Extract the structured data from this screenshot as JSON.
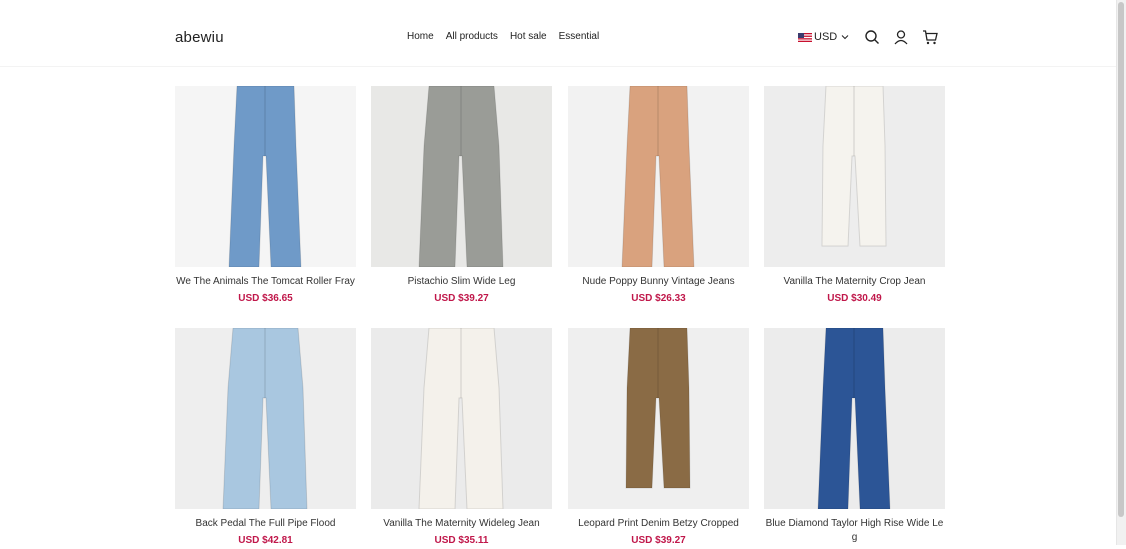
{
  "header": {
    "logo": "abewiu",
    "nav": [
      "Home",
      "All products",
      "Hot sale",
      "Essential"
    ],
    "currency": "USD",
    "icons": [
      "us-flag-icon",
      "chevron-down-icon",
      "search-icon",
      "user-icon",
      "cart-icon"
    ]
  },
  "products": [
    {
      "name": "We The Animals The Tomcat Roller Fray",
      "price": "USD $36.65",
      "bg": "#f5f5f5",
      "color": "#6f9ac8",
      "style": "flare"
    },
    {
      "name": "Pistachio Slim Wide Leg",
      "price": "USD $39.27",
      "bg": "#e8e8e6",
      "color": "#9a9c97",
      "style": "wide"
    },
    {
      "name": "Nude Poppy Bunny Vintage Jeans",
      "price": "USD $26.33",
      "bg": "#f2f2f2",
      "color": "#d9a27e",
      "style": "flare"
    },
    {
      "name": "Vanilla The Maternity Crop Jean",
      "price": "USD $30.49",
      "bg": "#ededed",
      "color": "#f5f3ee",
      "style": "crop"
    },
    {
      "name": "Back Pedal The Full Pipe Flood",
      "price": "USD $42.81",
      "bg": "#eeeeee",
      "color": "#a9c7e0",
      "style": "wide"
    },
    {
      "name": "Vanilla The Maternity Wideleg Jean",
      "price": "USD $35.11",
      "bg": "#ebebeb",
      "color": "#f4f1eb",
      "style": "wide"
    },
    {
      "name": "Leopard Print Denim Betzy Cropped",
      "price": "USD $39.27",
      "bg": "#efefef",
      "color": "#8a6b45",
      "style": "crop"
    },
    {
      "name": "Blue Diamond Taylor High Rise Wide Leg",
      "price": "",
      "bg": "#ececec",
      "color": "#2c5596",
      "style": "flare"
    }
  ],
  "colors": {
    "price": "#c0174a",
    "text": "#222222"
  }
}
